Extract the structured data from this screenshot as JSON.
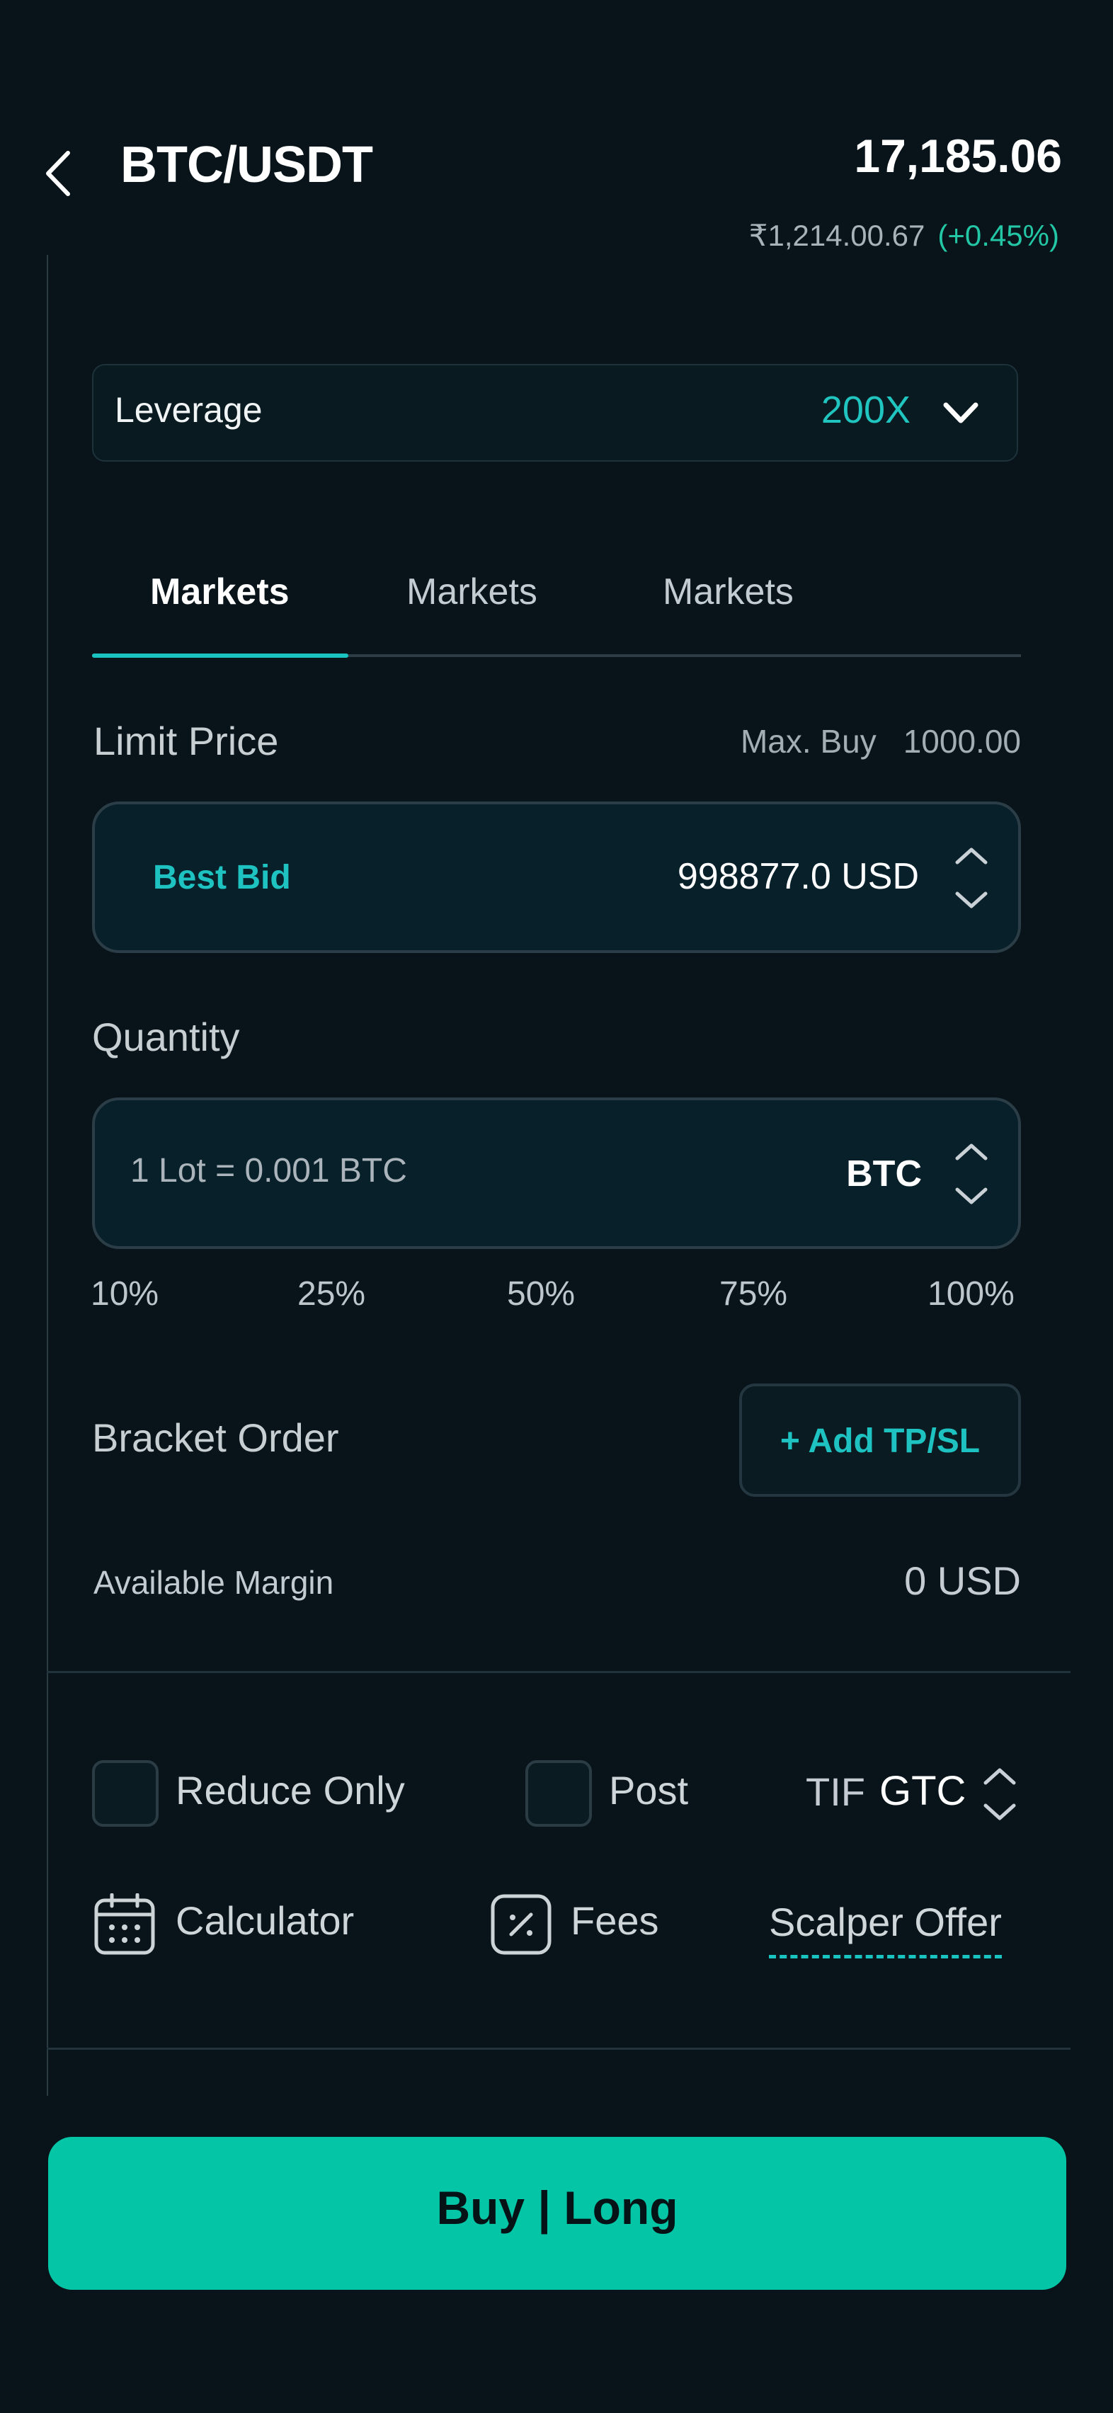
{
  "header": {
    "title": "BTC/USDT",
    "price": "17,185.06",
    "inr_price": "₹1,214.00.67",
    "change": "(+0.45%)"
  },
  "leverage": {
    "label": "Leverage",
    "value": "200X"
  },
  "tabs": [
    {
      "label": "Markets",
      "active": true
    },
    {
      "label": "Markets",
      "active": false
    },
    {
      "label": "Markets",
      "active": false
    }
  ],
  "limit_price": {
    "label": "Limit Price",
    "max_buy_label": "Max. Buy",
    "max_buy_value": "1000.00",
    "bid_label": "Best Bid",
    "bid_value": "998877.0 USD"
  },
  "quantity": {
    "label": "Quantity",
    "placeholder": "1 Lot = 0.001 BTC",
    "unit": "BTC",
    "percentages": [
      "10%",
      "25%",
      "50%",
      "75%",
      "100%"
    ]
  },
  "bracket": {
    "label": "Bracket Order",
    "button": "+ Add TP/SL"
  },
  "margin": {
    "label": "Available Margin",
    "value": "0 USD"
  },
  "options": {
    "reduce_only": "Reduce Only",
    "post": "Post",
    "tif_label": "TIF",
    "tif_value": "GTC"
  },
  "tools": {
    "calculator": "Calculator",
    "fees": "Fees",
    "scalper": "Scalper Offer"
  },
  "action": {
    "buy_label": "Buy | Long"
  },
  "colors": {
    "accent": "#19c4c0",
    "buy": "#04c6a6",
    "positive": "#23c7a6",
    "background": "#08141a"
  }
}
